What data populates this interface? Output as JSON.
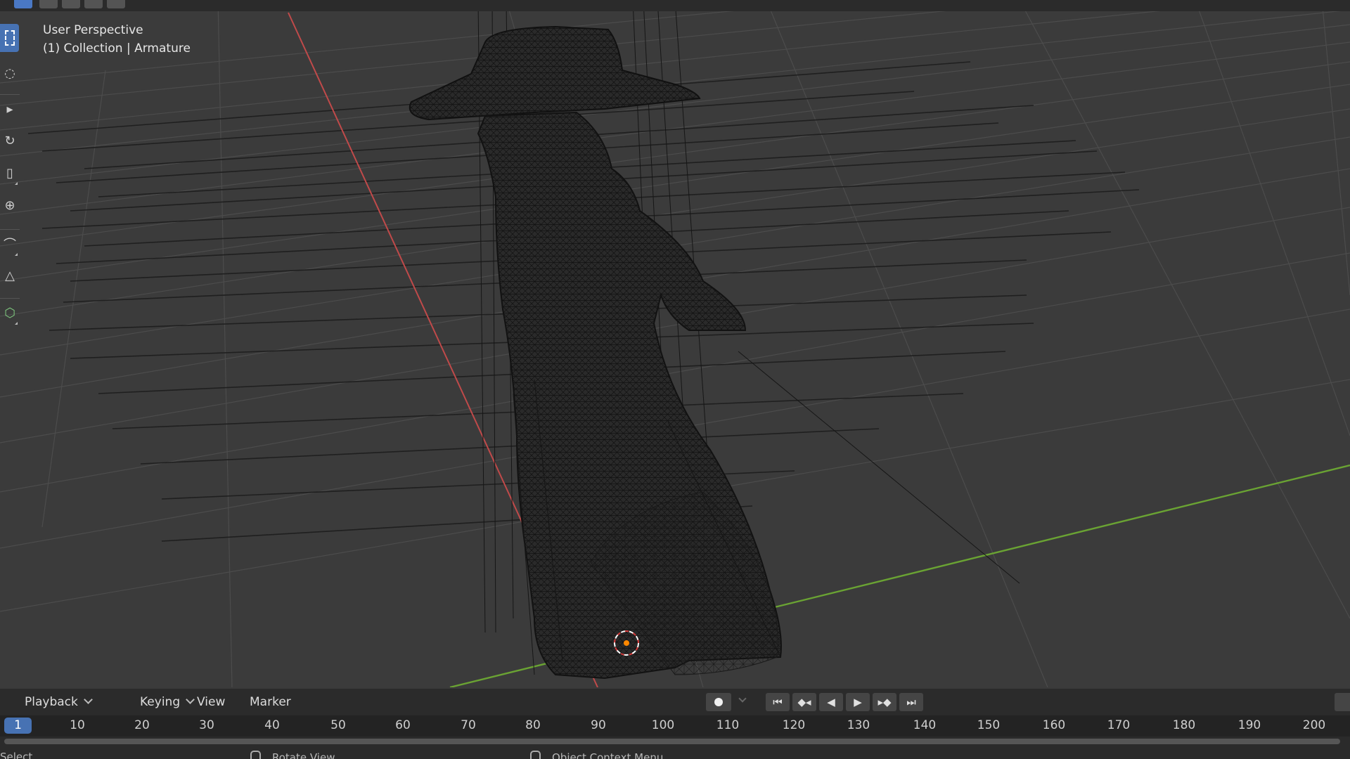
{
  "viewport": {
    "perspective_label": "User Perspective",
    "collection_label": "(1) Collection | Armature"
  },
  "header": {
    "mode_buttons": [
      "select-box-mode",
      "extend-mode",
      "subtract-mode",
      "invert-mode",
      "intersect-mode"
    ]
  },
  "toolbar": {
    "tools": [
      "select-box",
      "cursor",
      "move",
      "rotate",
      "scale",
      "transform",
      "annotate",
      "measure",
      "add-cube"
    ]
  },
  "timeline": {
    "menus": [
      "Playback",
      "Keying",
      "View",
      "Marker"
    ],
    "playback_controls": [
      "jump-to-start",
      "jump-to-previous-keyframe",
      "play-reverse",
      "play",
      "jump-to-next-keyframe",
      "jump-to-end"
    ],
    "current_frame": "1",
    "ticks": [
      "10",
      "20",
      "30",
      "40",
      "50",
      "60",
      "70",
      "80",
      "90",
      "100",
      "110",
      "120",
      "130",
      "140",
      "150",
      "160",
      "170",
      "180",
      "190",
      "200"
    ]
  },
  "status_bar": {
    "items": [
      "Select",
      "Rotate View",
      "Object Context Menu"
    ]
  },
  "colors": {
    "accent": "#4772b3",
    "x_axis": "#c04a4a",
    "y_axis": "#6aa333",
    "origin": "#ff8800"
  }
}
